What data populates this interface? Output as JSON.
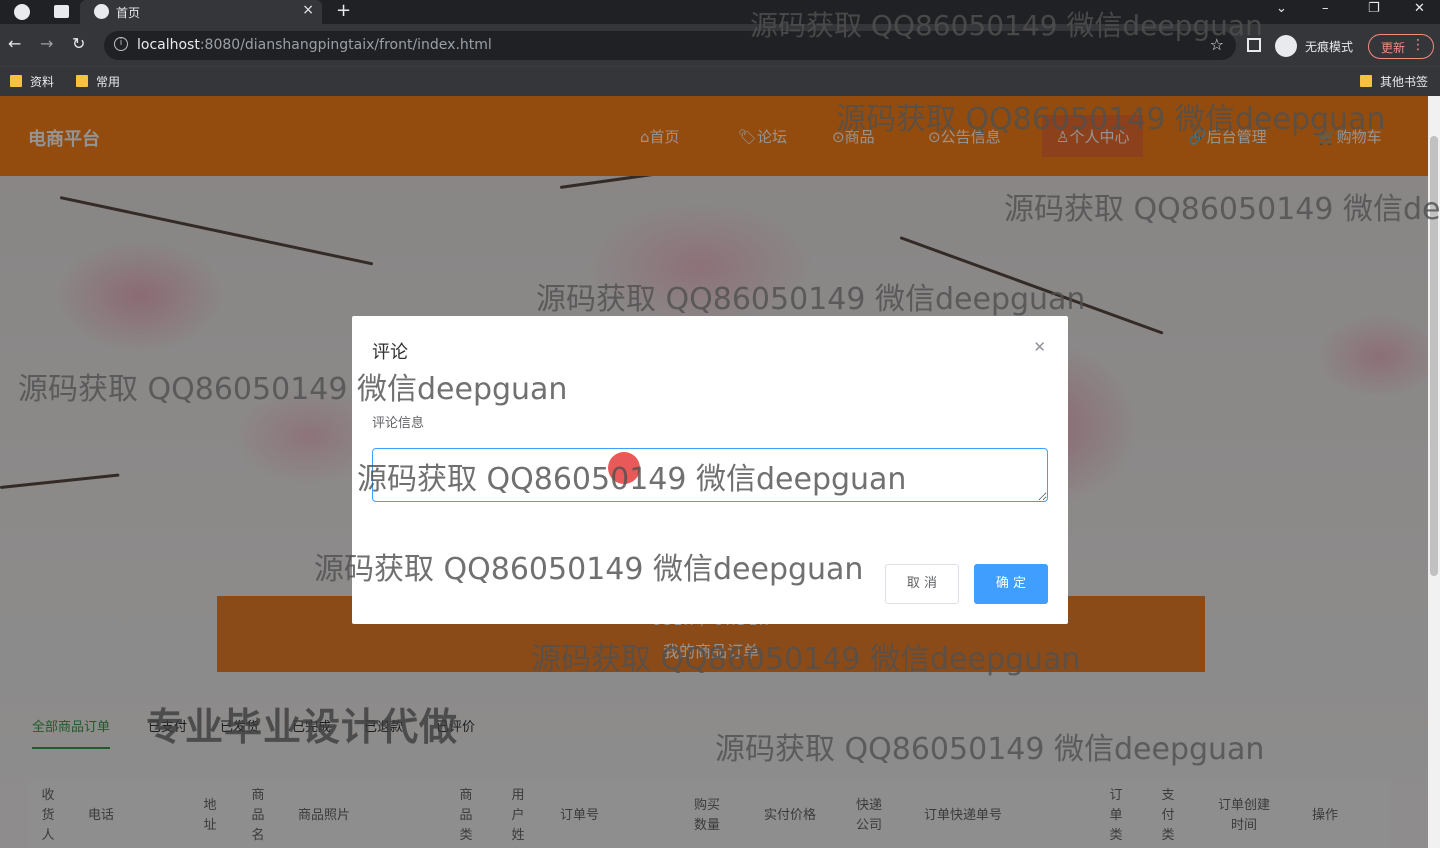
{
  "browser": {
    "tab_title": "首页",
    "url_host": "localhost",
    "url_rest": ":8080/dianshangpingtaix/front/index.html",
    "incognito_label": "无痕模式",
    "update_label": "更新",
    "bookmarks": [
      "资料",
      "常用"
    ],
    "other_bookmarks": "其他书签"
  },
  "nav": {
    "brand": "电商平台",
    "items": [
      "⌂首页",
      "🏷论坛",
      "⊙商品",
      "⊙公告信息",
      "♙个人中心",
      "🔗后台管理",
      "🛒购物车"
    ]
  },
  "banner": {
    "en": "USER / ORDER",
    "cn": "我的商品订单"
  },
  "order_tabs": [
    "全部商品订单",
    "已支付",
    "已发货",
    "已完成",
    "已退款",
    "已评价"
  ],
  "table_headers": [
    "收货人",
    "电话",
    "地址",
    "商品名称",
    "商品照片",
    "商品类型",
    "用户姓名",
    "订单号",
    "购买数量",
    "实付价格",
    "快递公司",
    "订单快递单号",
    "订单类型",
    "支付类型",
    "订单创建时间",
    "操作"
  ],
  "modal": {
    "title": "评论",
    "field_label": "评论信息",
    "textarea_value": "",
    "cancel_label": "取 消",
    "confirm_label": "确 定"
  },
  "watermarks": {
    "repeat": "源码获取 QQ86050149 微信deepguan",
    "partial": "源码获取 QQ86050149 微信dee",
    "big": "专业毕业设计代做"
  },
  "colors": {
    "nav_orange": "#fe8417",
    "primary_blue": "#409eff",
    "tab_green": "#3a9b4a"
  }
}
